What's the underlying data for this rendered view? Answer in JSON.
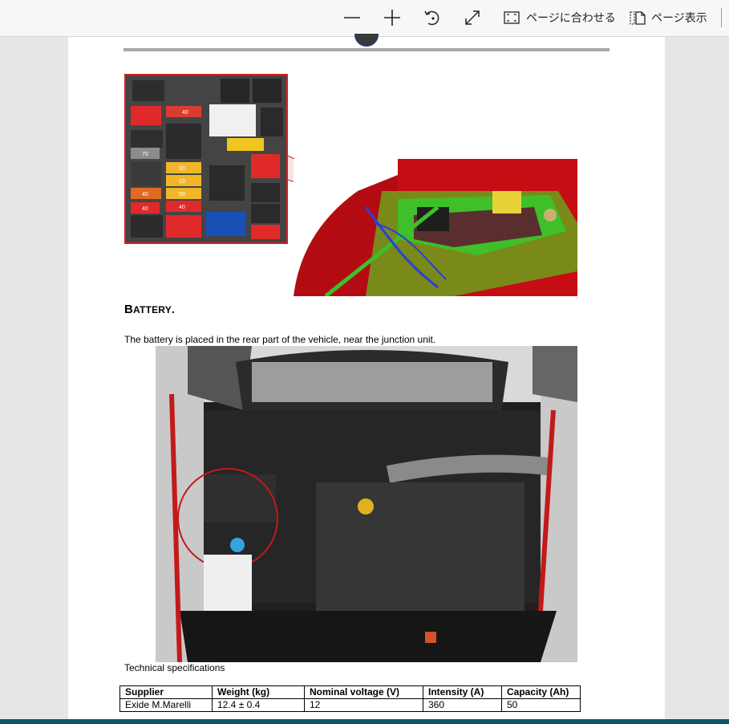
{
  "toolbar": {
    "zoom_out_icon": "minus-icon",
    "zoom_in_icon": "plus-icon",
    "rotate_icon": "rotate-icon",
    "fullscreen_icon": "expand-diagonal-icon",
    "fit_page_icon": "fit-page-icon",
    "fit_page_label": "ページに合わせる",
    "page_view_icon": "page-view-icon",
    "page_view_label": "ページ表示"
  },
  "document": {
    "battery_heading_first": "B",
    "battery_heading_rest": "ATTERY",
    "battery_heading_end": ".",
    "battery_text": "The battery is placed in the rear part of the vehicle, near the junction unit.",
    "specs_caption": "Technical specifications",
    "specs_table": {
      "headers": [
        "Supplier",
        "Weight (kg)",
        "Nominal voltage (V)",
        "Intensity (A)",
        "Capacity (Ah)"
      ],
      "rows": [
        [
          "Exide M.Marelli",
          "12.4 ± 0.4",
          "12",
          "360",
          "50"
        ]
      ]
    },
    "fuse_labels": [
      "40",
      "70",
      "40",
      "30",
      "10",
      "50",
      "40",
      "40"
    ]
  },
  "colors": {
    "toolbar_bg": "#f7f7f7",
    "page_bg": "#ffffff",
    "viewer_bg": "#e6e6e6",
    "callout_red": "#d42020",
    "bottom_bar": "#135468"
  }
}
